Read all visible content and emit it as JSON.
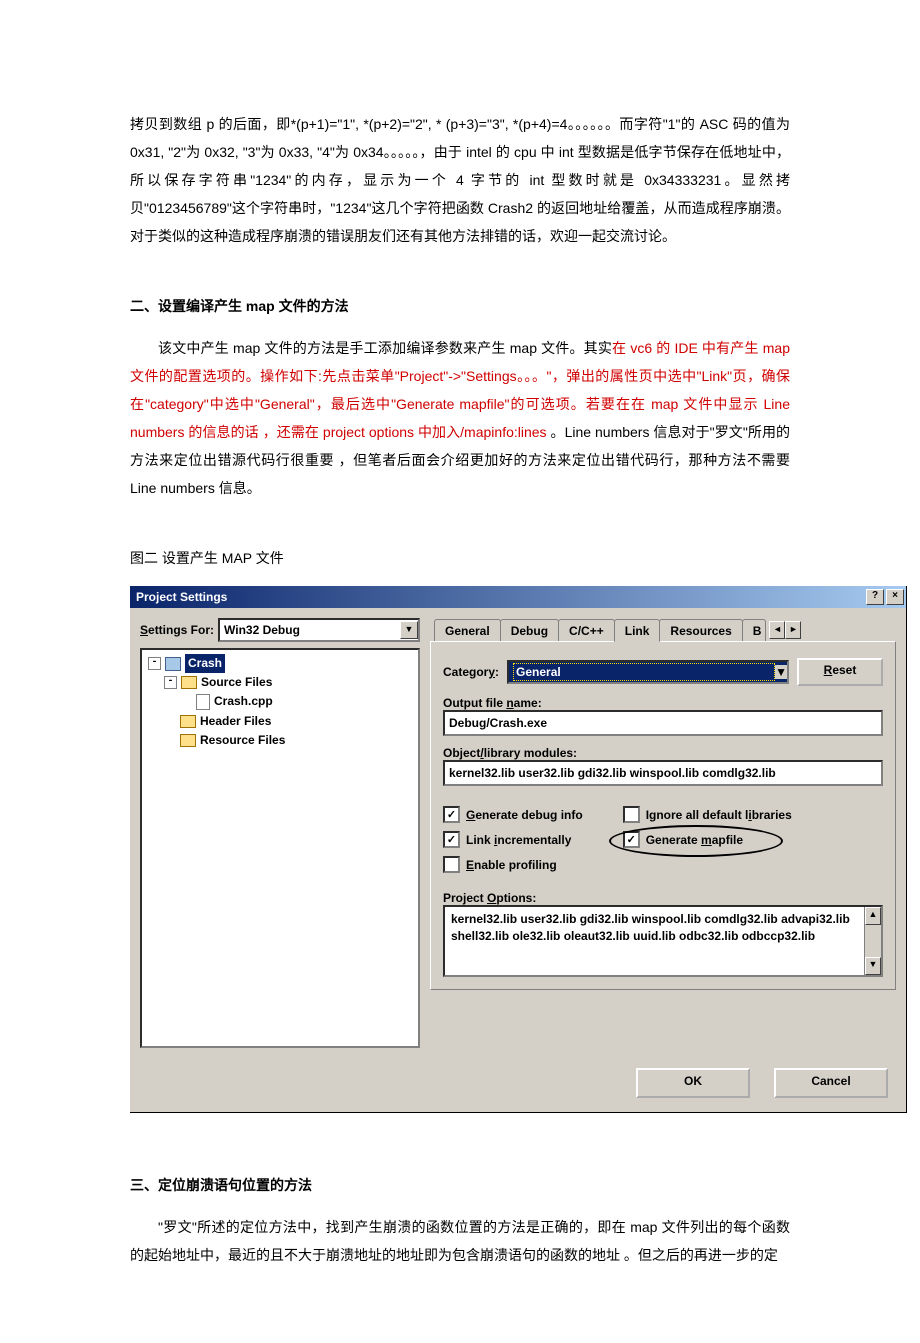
{
  "body": {
    "para1": "拷贝到数组 p 的后面，即*(p+1)=\"1\", *(p+2)=\"2\", * (p+3)=\"3\", *(p+4)=4。。。。。。而字符\"1\"的 ASC 码的值为 0x31, \"2\"为 0x32, \"3\"为 0x33, \"4\"为 0x34。。。。。，由于 intel 的 cpu 中 int 型数据是低字节保存在低地址中，所以保存字符串\"1234\"的内存，显示为一个 4 字节的 int 型数时就是 0x34333231。显然拷贝\"0123456789\"这个字符串时，\"1234\"这几个字符把函数 Crash2 的返回地址给覆盖，从而造成程序崩溃。对于类似的这种造成程序崩溃的错误朋友们还有其他方法排错的话，欢迎一起交流讨论。",
    "h2": "二、设置编译产生 map 文件的方法",
    "p2a": "该文中产生 map 文件的方法是手工添加编译参数来产生 map 文件。其实",
    "p2red1": "在 vc6 的 IDE 中有产生 map 文件的配置选项的",
    "p2b": "。操作如下:先点击菜单\"Project\"->\"Settings。。。\"，弹出的属性页中选中\"Link\"页，确保在\"category\"中选中\"General\"，最后选中\"Generate mapfile\"的可选项。若要在在 map 文件中显示 Line numbers 的信息的话 ，还需在 project options 中加入/mapinfo:lines ",
    "p2c": "。Line numbers 信息对于\"罗文\"所用的方法来定位出错源代码行很重要 ，但笔者后面会介绍更加好的方法来定位出错代码行，那种方法不需要 Line numbers 信息。",
    "figcap": "图二 设置产生 MAP 文件",
    "h3": "三、定位崩溃语句位置的方法",
    "p3": "\"罗文\"所述的定位方法中，找到产生崩溃的函数位置的方法是正确的，即在 map 文件列出的每个函数的起始地址中，最近的且不大于崩溃地址的地址即为包含崩溃语句的函数的地址 。但之后的再进一步的定"
  },
  "dialog": {
    "title": "Project Settings",
    "help": "?",
    "close": "×",
    "settingsForLabel": "Settings For:",
    "settingsForValue": "Win32 Debug",
    "tree": {
      "root": "Crash",
      "src": "Source Files",
      "cpp": "Crash.cpp",
      "hdr": "Header Files",
      "res": "Resource Files"
    },
    "tabs": {
      "general": "General",
      "debug": "Debug",
      "cpp": "C/C++",
      "link": "Link",
      "resources": "Resources",
      "build": "B"
    },
    "categoryLabel": "Category:",
    "categoryValue": "General",
    "reset": "Reset",
    "outputLabel": "Output file name:",
    "outputValue": "Debug/Crash.exe",
    "objlibLabel": "Object/library modules:",
    "objlibValue": "kernel32.lib user32.lib gdi32.lib winspool.lib comdlg32.lib",
    "chk": {
      "gdi": "Generate debug info",
      "ignore": "Ignore all default libraries",
      "linkinc": "Link incrementally",
      "mapfile": "Generate mapfile",
      "profile": "Enable profiling"
    },
    "projOptLabel": "Project Options:",
    "projOptValue": "kernel32.lib user32.lib gdi32.lib winspool.lib comdlg32.lib advapi32.lib shell32.lib ole32.lib oleaut32.lib uuid.lib odbc32.lib odbccp32.lib",
    "ok": "OK",
    "cancel": "Cancel"
  }
}
